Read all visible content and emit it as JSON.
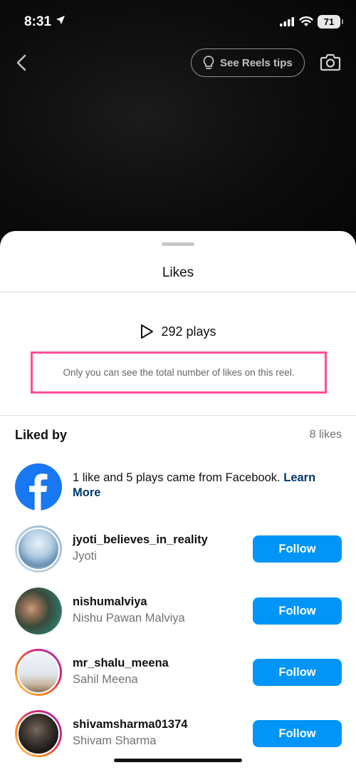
{
  "status_bar": {
    "time": "8:31",
    "battery": "71"
  },
  "top_bar": {
    "reels_tips_label": "See Reels tips"
  },
  "sheet": {
    "title": "Likes",
    "plays": "292 plays",
    "notice": "Only you can see the total number of likes on this reel.",
    "liked_by_label": "Liked by",
    "likes_count": "8 likes",
    "facebook_note": "1 like and 5 plays came from Facebook. ",
    "facebook_link": "Learn More"
  },
  "users": [
    {
      "username": "jyoti_believes_in_reality",
      "full_name": "Jyoti",
      "button": "Follow"
    },
    {
      "username": "nishumalviya",
      "full_name": "Nishu Pawan Malviya",
      "button": "Follow"
    },
    {
      "username": "mr_shalu_meena",
      "full_name": "Sahil Meena",
      "button": "Follow"
    },
    {
      "username": "shivamsharma01374",
      "full_name": "Shivam Sharma",
      "button": "Follow"
    }
  ],
  "colors": {
    "accent": "#0095f6",
    "highlight_box": "#ff4f9a",
    "link": "#00376b",
    "facebook": "#1877f2"
  }
}
